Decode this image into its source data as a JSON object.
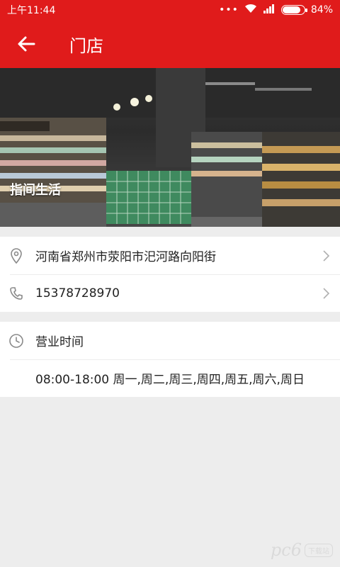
{
  "status": {
    "time": "上午11:44",
    "dots": "•••",
    "battery": "84%",
    "battery_level": 0.84
  },
  "appbar": {
    "title": "门店"
  },
  "store": {
    "name": "指间生活",
    "address": "河南省郑州市荥阳市汜河路向阳街",
    "phone": "15378728970"
  },
  "hours": {
    "label": "营业时间",
    "value": "08:00-18:00 周一,周二,周三,周四,周五,周六,周日"
  },
  "watermark": {
    "brand": "pc6",
    "sub": "下载站"
  },
  "colors": {
    "brand_red": "#e01b1b",
    "background": "#ededed"
  }
}
